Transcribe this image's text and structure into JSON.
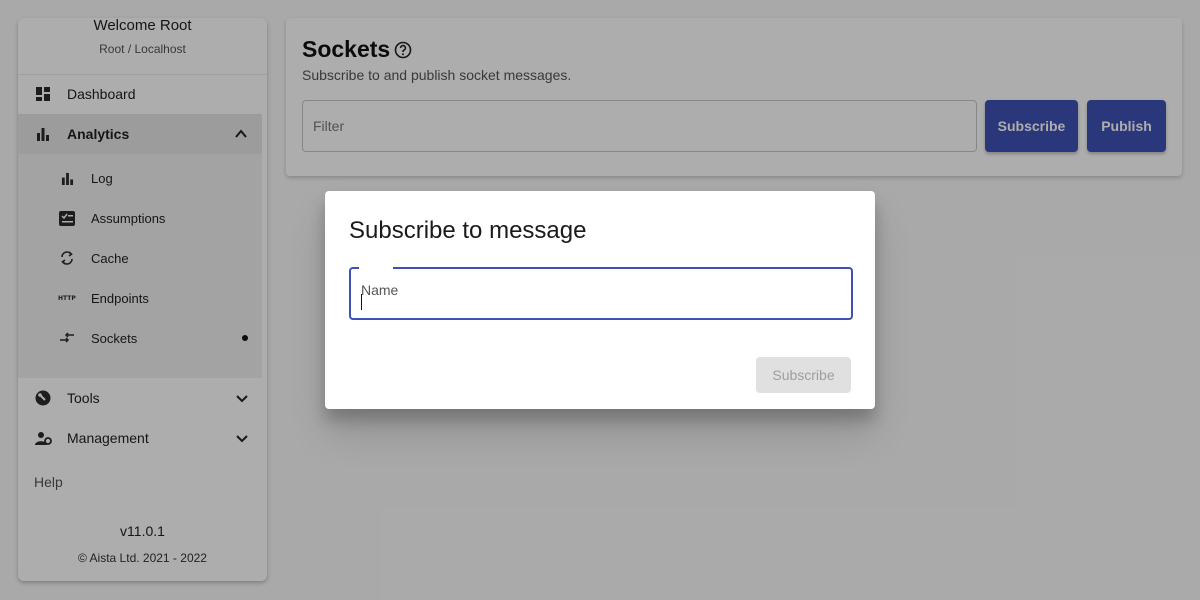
{
  "sidebar": {
    "welcome": "Welcome Root",
    "context": "Root / Localhost",
    "items": [
      {
        "label": "Dashboard",
        "icon": "dashboard-icon"
      },
      {
        "label": "Analytics",
        "icon": "bar-chart-icon",
        "expanded": true
      },
      {
        "label": "Tools",
        "icon": "tools-icon"
      },
      {
        "label": "Management",
        "icon": "manage-accounts-icon"
      }
    ],
    "analytics_children": [
      {
        "label": "Log",
        "icon": "bar-chart-icon"
      },
      {
        "label": "Assumptions",
        "icon": "checklist-icon"
      },
      {
        "label": "Cache",
        "icon": "refresh-icon"
      },
      {
        "label": "Endpoints",
        "icon": "http-icon"
      },
      {
        "label": "Sockets",
        "icon": "swap-icon",
        "active": true
      }
    ],
    "help": "Help",
    "version": "v11.0.1",
    "copyright": "© Aista Ltd. 2021 - 2022"
  },
  "main": {
    "title": "Sockets",
    "subtitle": "Subscribe to and publish socket messages.",
    "filter_placeholder": "Filter",
    "subscribe_label": "Subscribe",
    "publish_label": "Publish"
  },
  "dialog": {
    "title": "Subscribe to message",
    "name_placeholder": "Name",
    "subscribe_label": "Subscribe"
  },
  "colors": {
    "accent": "#3f51b5",
    "overlay": "rgba(0,0,0,0.32)"
  }
}
